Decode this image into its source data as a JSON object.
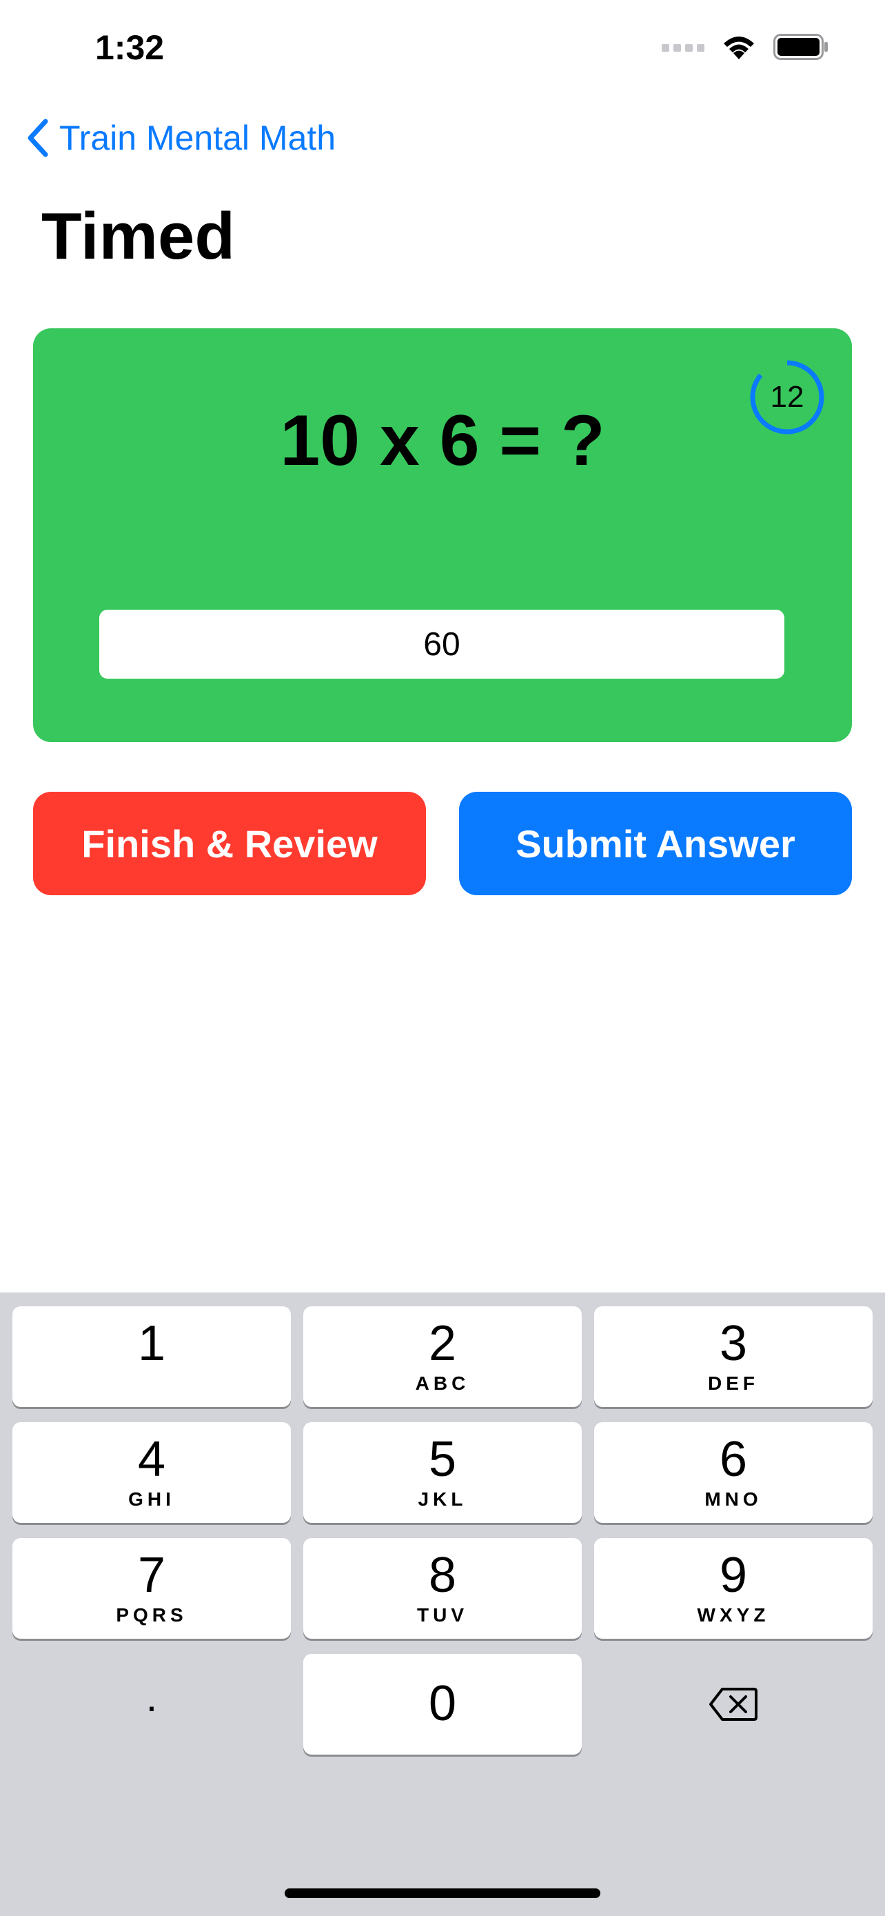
{
  "status_bar": {
    "time": "1:32"
  },
  "nav": {
    "back_label": "Train Mental Math"
  },
  "page": {
    "title": "Timed"
  },
  "quiz": {
    "question": "10 x 6 = ?",
    "timer_value": "12",
    "answer_value": "60",
    "card_color": "#37c75c",
    "timer_color": "#0a7aff"
  },
  "actions": {
    "finish_label": "Finish & Review",
    "submit_label": "Submit Answer",
    "finish_color": "#ff3b30",
    "submit_color": "#0a7aff"
  },
  "keypad": {
    "keys": [
      {
        "digit": "1",
        "letters": ""
      },
      {
        "digit": "2",
        "letters": "ABC"
      },
      {
        "digit": "3",
        "letters": "DEF"
      },
      {
        "digit": "4",
        "letters": "GHI"
      },
      {
        "digit": "5",
        "letters": "JKL"
      },
      {
        "digit": "6",
        "letters": "MNO"
      },
      {
        "digit": "7",
        "letters": "PQRS"
      },
      {
        "digit": "8",
        "letters": "TUV"
      },
      {
        "digit": "9",
        "letters": "WXYZ"
      },
      {
        "digit": "0",
        "letters": ""
      }
    ],
    "decimal_label": ".",
    "delete_icon": "backspace-icon"
  }
}
